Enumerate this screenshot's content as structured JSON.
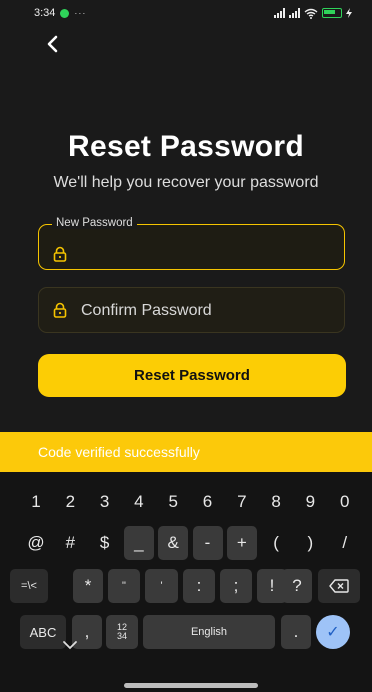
{
  "status_bar": {
    "time": "3:34",
    "more": "···"
  },
  "header": {
    "back_label": "‹"
  },
  "page": {
    "title": "Reset Password",
    "subtitle": "We'll help you recover your password"
  },
  "form": {
    "new_password": {
      "label": "New Password",
      "value": "",
      "placeholder": ""
    },
    "confirm_password": {
      "placeholder": "Confirm Password",
      "value": ""
    },
    "submit_label": "Reset Password"
  },
  "toast": {
    "message": "Code verified successfully"
  },
  "keyboard": {
    "row1": [
      "1",
      "2",
      "3",
      "4",
      "5",
      "6",
      "7",
      "8",
      "9",
      "0"
    ],
    "row2": [
      "@",
      "#",
      "$",
      "_",
      "&",
      "-",
      "+",
      "(",
      ")",
      "/"
    ],
    "row3": [
      "=\\<",
      "*",
      "\"",
      "'",
      ":",
      ";",
      "!",
      "?"
    ],
    "row4": {
      "abc": "ABC",
      "comma": ",",
      "numpad_top": "12",
      "numpad_bottom": "34",
      "space": "English",
      "period": ".",
      "done": "✓"
    }
  },
  "colors": {
    "accent": "#fccd05",
    "background": "#1a1a1a",
    "toast": "#fcc90a"
  }
}
